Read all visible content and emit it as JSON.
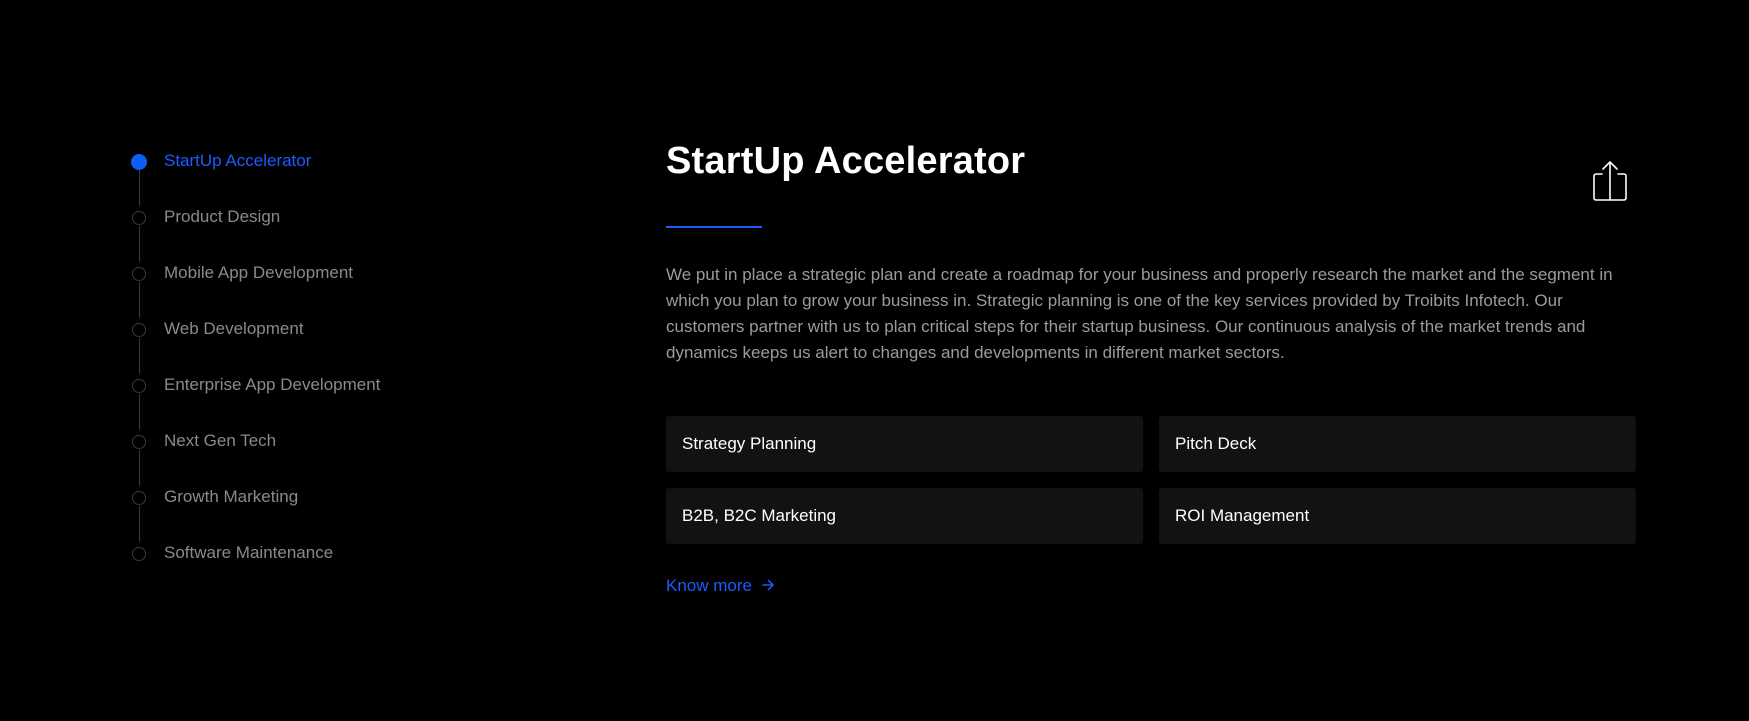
{
  "timeline": {
    "items": [
      {
        "label": "StartUp Accelerator",
        "active": true
      },
      {
        "label": "Product Design",
        "active": false
      },
      {
        "label": "Mobile App Development",
        "active": false
      },
      {
        "label": "Web Development",
        "active": false
      },
      {
        "label": "Enterprise App Development",
        "active": false
      },
      {
        "label": "Next Gen Tech",
        "active": false
      },
      {
        "label": "Growth Marketing",
        "active": false
      },
      {
        "label": "Software Maintenance",
        "active": false
      }
    ]
  },
  "main": {
    "title": "StartUp Accelerator",
    "description": "We put in place a strategic plan and create a roadmap for your business and properly research the market and the segment in which you plan to grow your business in. Strategic planning is one of the key services provided by Troibits Infotech. Our customers partner with us to plan critical steps for their startup business. Our continuous analysis of the market trends and dynamics keeps us alert to changes and developments in different market sectors.",
    "cards": [
      "Strategy Planning",
      "Pitch Deck",
      "B2B, B2C Marketing",
      "ROI Management"
    ],
    "know_more_label": "Know more",
    "share_icon": "share-icon"
  },
  "colors": {
    "background": "#000000",
    "accent": "#1a5cff",
    "card_bg": "#121212",
    "muted_text": "#8a8a8a"
  }
}
